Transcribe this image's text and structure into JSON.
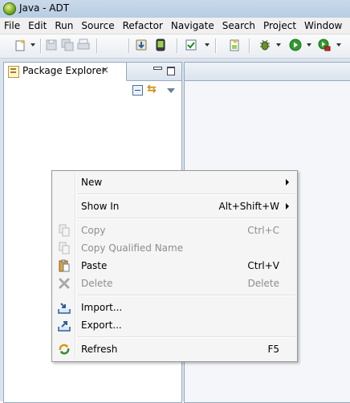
{
  "window": {
    "title": "Java - ADT"
  },
  "menubar": {
    "items": [
      "File",
      "Edit",
      "Run",
      "Source",
      "Refactor",
      "Navigate",
      "Search",
      "Project",
      "Window"
    ]
  },
  "package_explorer": {
    "tab_label": "Package Explorer",
    "close_glyph": "×"
  },
  "context_menu": {
    "new": {
      "label": "New"
    },
    "show_in": {
      "label": "Show In",
      "shortcut": "Alt+Shift+W"
    },
    "copy": {
      "label": "Copy",
      "shortcut": "Ctrl+C",
      "enabled": false
    },
    "copy_qualified": {
      "label": "Copy Qualified Name",
      "enabled": false
    },
    "paste": {
      "label": "Paste",
      "shortcut": "Ctrl+V"
    },
    "delete": {
      "label": "Delete",
      "shortcut": "Delete",
      "enabled": false
    },
    "import": {
      "label": "Import..."
    },
    "export": {
      "label": "Export..."
    },
    "refresh": {
      "label": "Refresh",
      "shortcut": "F5"
    }
  },
  "colors": {
    "menu_bg": "#f5f5f5",
    "disabled_text": "#8d8d8d",
    "view_border": "#98a9bd",
    "workspace_bg": "#dbe4ee"
  }
}
